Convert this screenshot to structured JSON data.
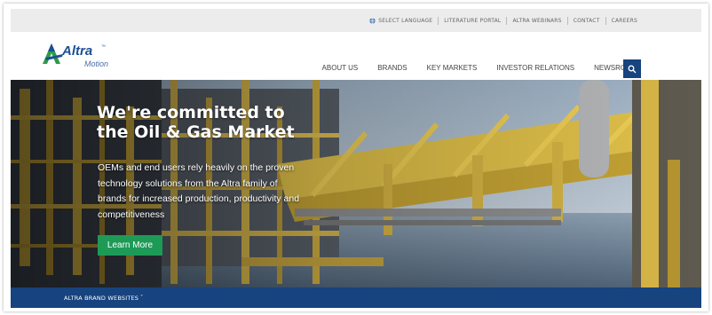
{
  "utility": {
    "select_language": "SELECT LANGUAGE",
    "literature_portal": "LITERATURE PORTAL",
    "altra_webinars": "ALTRA WEBINARS",
    "contact": "CONTACT",
    "careers": "CAREERS"
  },
  "logo": {
    "word": "Altra",
    "tm": "™",
    "sub": "Motion"
  },
  "nav": [
    "ABOUT US",
    "BRANDS",
    "KEY MARKETS",
    "INVESTOR RELATIONS",
    "NEWSROOM"
  ],
  "icons": {
    "search": "search-icon",
    "globe": "globe-icon",
    "caret": "chevron-down-icon"
  },
  "hero": {
    "title_line1": "We're committed to",
    "title_line2": "the Oil & Gas Market",
    "body": "OEMs and end users rely heavily on the proven technology solutions from the Altra family of brands for increased production, productivity and competitiveness",
    "cta": "Learn More"
  },
  "brand_bar": {
    "label": "ALTRA BRAND WEBSITES",
    "caret": "˅"
  },
  "colors": {
    "navy": "#17437e",
    "green": "#1e9a57",
    "utility_bg": "#ececec",
    "logo_blue": "#1c4f94",
    "logo_green": "#2e9b48"
  }
}
